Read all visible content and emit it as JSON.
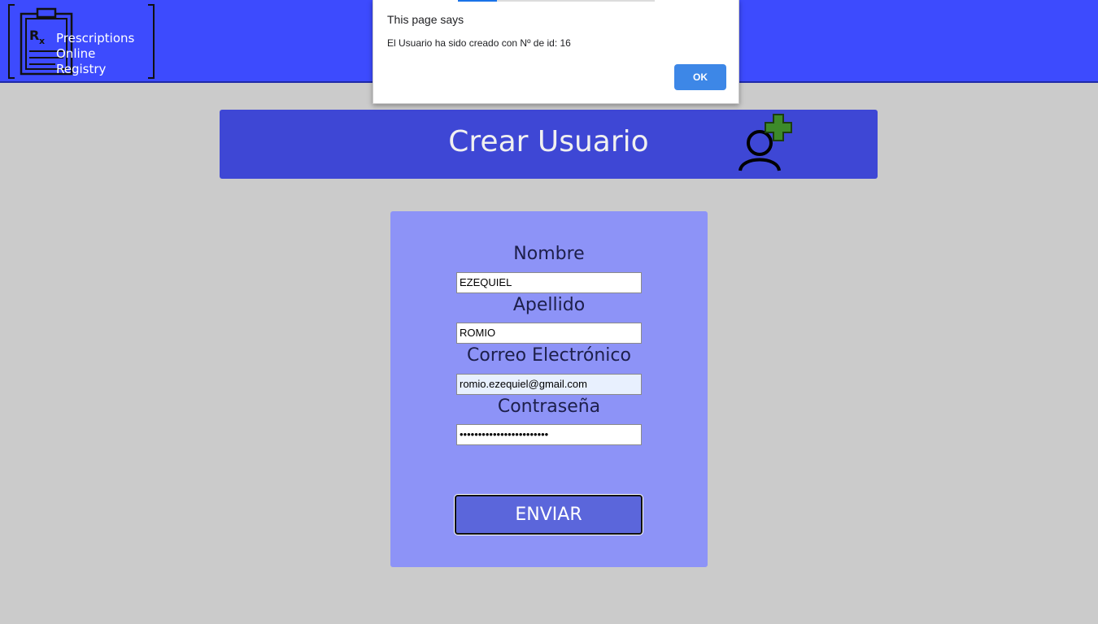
{
  "header": {
    "logo_lines": [
      "Prescriptions",
      "Online",
      "Registry"
    ]
  },
  "dialog": {
    "title": "This page says",
    "message": "El Usuario ha sido creado con Nº de id: 16",
    "ok_label": "OK"
  },
  "banner": {
    "title": "Crear Usuario",
    "icon": "add-user-icon"
  },
  "form": {
    "nombre_label": "Nombre",
    "nombre_value": "EZEQUIEL",
    "apellido_label": "Apellido",
    "apellido_value": "ROMIO",
    "correo_label": "Correo Electrónico",
    "correo_value": "romio.ezequiel@gmail.com",
    "contrasena_label": "Contraseña",
    "contrasena_value": "••••••••••••••••••••••••",
    "submit_label": "ENVIAR"
  },
  "colors": {
    "topbar": "#3d4bfe",
    "background": "#cbcbcb",
    "banner": "#3e47d5",
    "card": "#8d93f7",
    "button": "#5b66db",
    "dialog_button": "#3d87e7",
    "plus_icon": "#3d8a2a"
  }
}
